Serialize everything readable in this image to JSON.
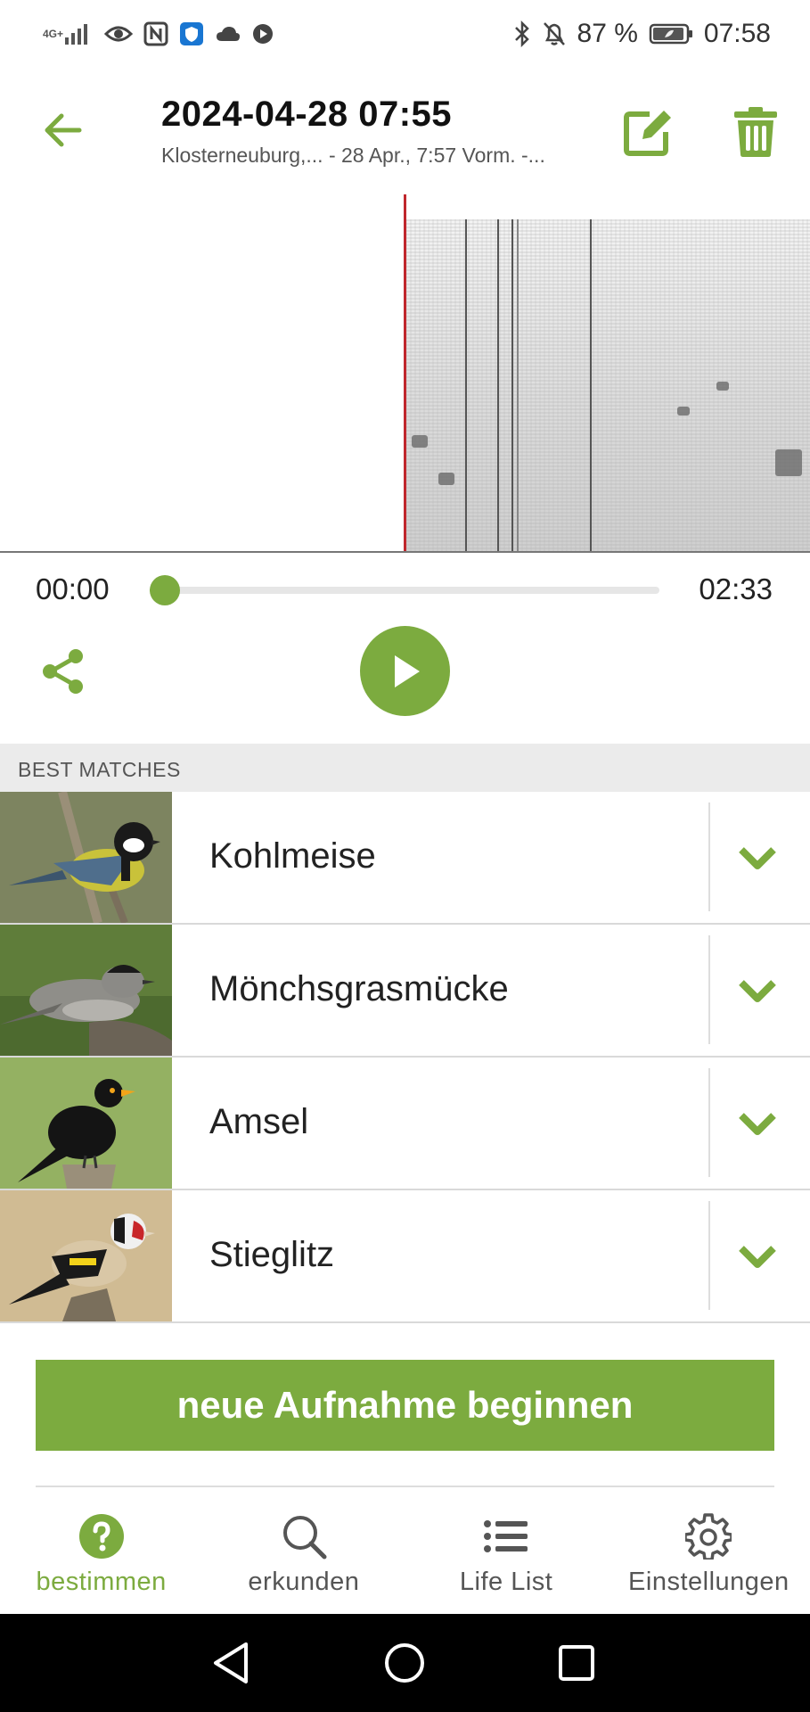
{
  "status_bar": {
    "network": "4G+",
    "battery_percent": "87 %",
    "time": "07:58",
    "icons": [
      "signal-icon",
      "eye-icon",
      "nfc-icon",
      "shield-icon",
      "cloud-icon",
      "play-circle-icon",
      "bluetooth-icon",
      "bell-off-icon",
      "battery-icon"
    ]
  },
  "header": {
    "title": "2024-04-28 07:55",
    "subtitle": "Klosterneuburg,... - 28 Apr., 7:57 Vorm. -..."
  },
  "player": {
    "current_time": "00:00",
    "total_time": "02:33",
    "progress": 0.03
  },
  "matches_section": {
    "header": "BEST MATCHES",
    "items": [
      {
        "name": "Kohlmeise"
      },
      {
        "name": "Mönchsgrasmücke"
      },
      {
        "name": "Amsel"
      },
      {
        "name": "Stieglitz"
      }
    ]
  },
  "actions": {
    "new_recording_label": "neue Aufnahme beginnen"
  },
  "bottom_nav": {
    "items": [
      {
        "label": "bestimmen",
        "icon": "help-circle-icon",
        "active": true
      },
      {
        "label": "erkunden",
        "icon": "search-icon",
        "active": false
      },
      {
        "label": "Life List",
        "icon": "list-icon",
        "active": false
      },
      {
        "label": "Einstellungen",
        "icon": "gear-icon",
        "active": false
      }
    ]
  },
  "colors": {
    "accent": "#7cab3f",
    "playhead": "#c0272d",
    "section_bg": "#ebebeb",
    "system_nav_bg": "#000000"
  }
}
